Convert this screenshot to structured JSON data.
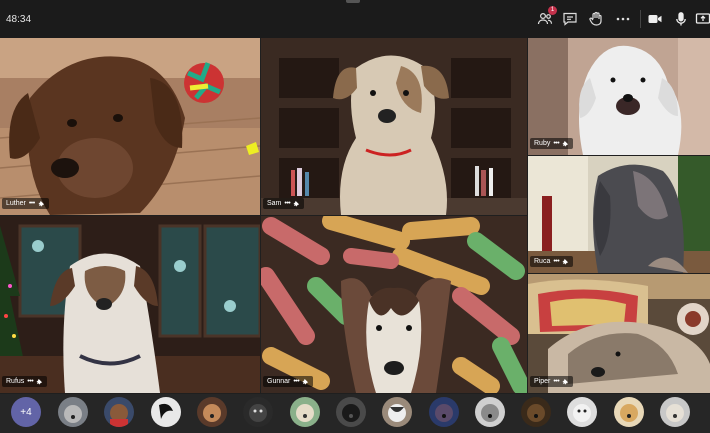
{
  "meeting": {
    "time": "48:34"
  },
  "toolbar": {
    "participants_badge": "1",
    "icons": [
      "people-icon",
      "chat-icon",
      "raise-hand-icon",
      "more-options-icon",
      "camera-icon",
      "mic-icon",
      "share-icon"
    ]
  },
  "participants": [
    {
      "name": "Luther"
    },
    {
      "name": "Sam"
    },
    {
      "name": "Ruby"
    },
    {
      "name": "Ruca"
    },
    {
      "name": "Rufus"
    },
    {
      "name": "Gunnar"
    },
    {
      "name": "Piper"
    }
  ],
  "tile_menu": "•••",
  "overflow": {
    "label": "+4"
  },
  "colors": {
    "accent": "#6264a7",
    "badge": "#c4314b",
    "background": "#1f1f1f"
  }
}
